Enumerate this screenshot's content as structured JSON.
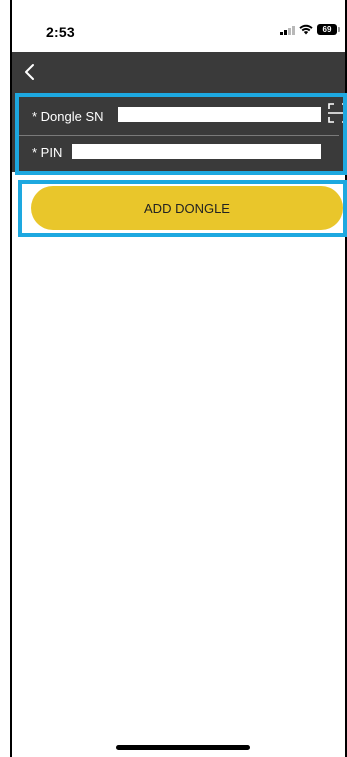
{
  "status_bar": {
    "time": "2:53",
    "battery": "69",
    "signal_icon": "cellular-signal-icon",
    "wifi_icon": "wifi-icon",
    "battery_icon": "battery-icon"
  },
  "navbar": {
    "back_icon": "chevron-left-icon",
    "background": "#3a3a3a"
  },
  "form": {
    "dongle_sn": {
      "label": "* Dongle SN",
      "value": ""
    },
    "pin": {
      "label": "* PIN",
      "value": ""
    },
    "scan_icon": "scan-icon"
  },
  "actions": {
    "add_label": "ADD DONGLE",
    "accent": "#e9c62b"
  },
  "highlight_color": "#1da8e0"
}
